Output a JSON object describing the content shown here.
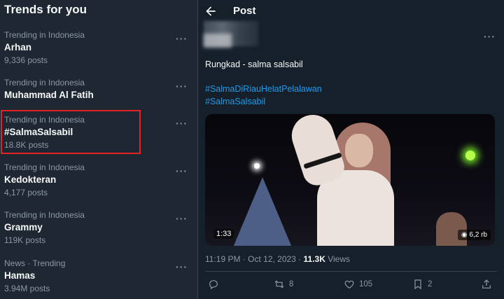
{
  "trends": {
    "title": "Trends for you",
    "items": [
      {
        "meta": "Trending in Indonesia",
        "name": "Arhan",
        "count": "9,336 posts"
      },
      {
        "meta": "Trending in Indonesia",
        "name": "Muhammad Al Fatih",
        "count": ""
      },
      {
        "meta": "Trending in Indonesia",
        "name": "#SalmaSalsabil",
        "count": "18.8K posts"
      },
      {
        "meta": "Trending in Indonesia",
        "name": "Kedokteran",
        "count": "4,177 posts"
      },
      {
        "meta": "Trending in Indonesia",
        "name": "Grammy",
        "count": "119K posts"
      },
      {
        "meta": "News · Trending",
        "name": "Hamas",
        "count": "3.94M posts"
      }
    ],
    "more_label": "···"
  },
  "post": {
    "header_title": "Post",
    "more_label": "···",
    "text": "Rungkad - salma salsabil",
    "hashtags": [
      "#SalmaDiRiauHelatPelalawan",
      "#SalmaSalsabil"
    ],
    "video": {
      "duration": "1:33",
      "views": "6,2 rb"
    },
    "time": "11:19 PM · Oct 12, 2023 · ",
    "views_count": "11.3K",
    "views_label": " Views",
    "actions": {
      "reply": "",
      "repost": "8",
      "like": "105",
      "bookmark": "2",
      "share": ""
    }
  },
  "colors": {
    "accent": "#1d9bf0",
    "highlight": "#e0242a"
  }
}
